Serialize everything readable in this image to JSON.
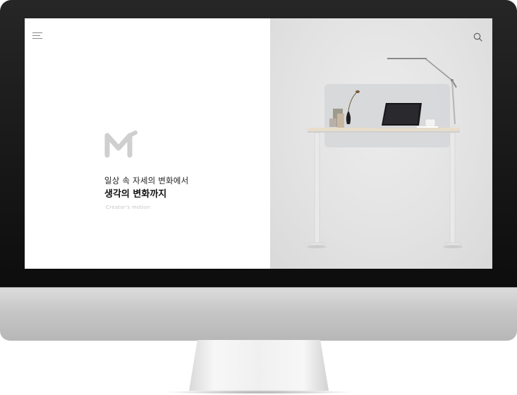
{
  "site": {
    "menu_icon": "hamburger-menu-icon",
    "search_icon": "search-icon",
    "logo_icon": "m1-brand-logo"
  },
  "hero": {
    "subtitle": "일상 속 자세의 변화에서",
    "title": "생각의 변화까지",
    "caption": "Creator's motion"
  },
  "product": {
    "image": "standing-desk-with-lamp-and-laptop"
  },
  "colors": {
    "bezel": "#141414",
    "chin": "#c6c6c6",
    "screen_left": "#ffffff",
    "screen_right": "#e2e2e3",
    "logo": "#cfcfcf"
  }
}
